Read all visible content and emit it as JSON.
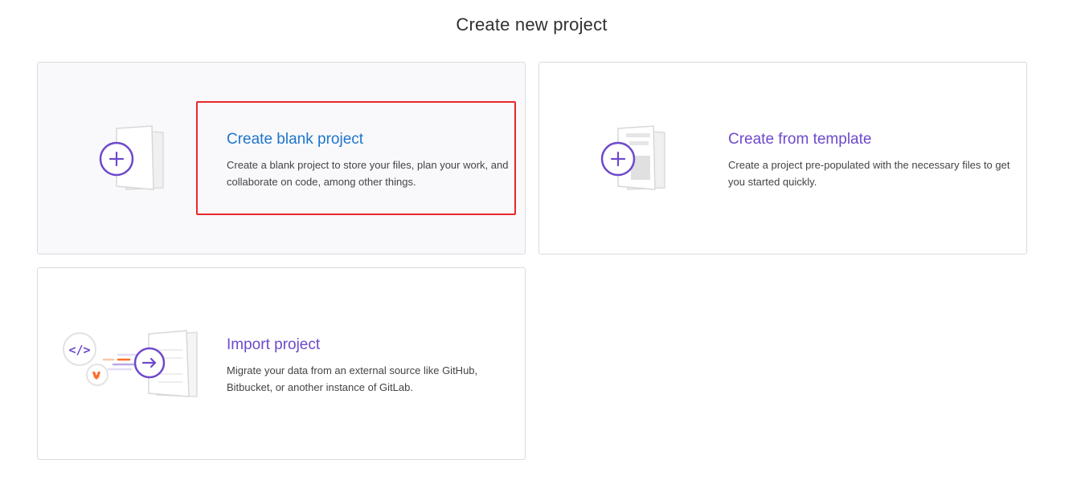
{
  "page": {
    "title": "Create new project"
  },
  "cards": {
    "blank": {
      "title": "Create blank project",
      "description": "Create a blank project to store your files, plan your work, and collaborate on code, among other things.",
      "icon": "blank-project-icon"
    },
    "template": {
      "title": "Create from template",
      "description": "Create a project pre-populated with the necessary files to get you started quickly.",
      "icon": "template-project-icon"
    },
    "import": {
      "title": "Import project",
      "description": "Migrate your data from an external source like GitHub, Bitbucket, or another instance of GitLab.",
      "icon": "import-project-icon"
    }
  },
  "colors": {
    "accent_purple": "#6e49cb",
    "link_blue": "#1f75cb",
    "highlight_red": "#e8282b",
    "border": "#dbdbdb",
    "gitlab_orange": "#fc6d26"
  }
}
